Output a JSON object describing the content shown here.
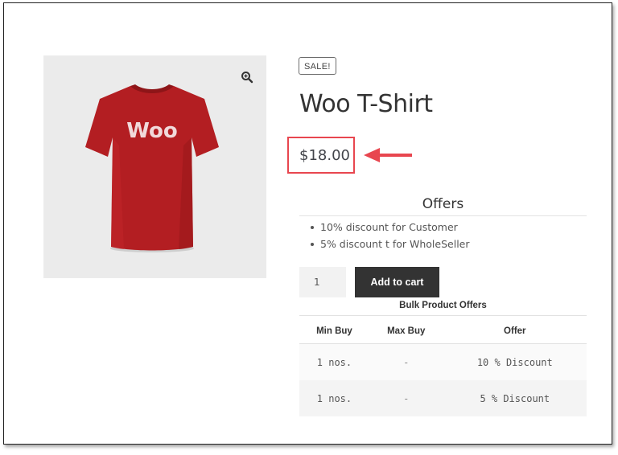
{
  "product": {
    "badge": "SALE!",
    "title": "Woo T-Shirt",
    "price": "$18.00",
    "image_label": "Woo",
    "colors": {
      "shirt": "#b31e22",
      "highlight": "#e8464f",
      "button": "#333333"
    }
  },
  "offers": {
    "title": "Offers",
    "items": [
      "10% discount for Customer",
      "5% discount t for WholeSeller"
    ]
  },
  "cart": {
    "quantity": "1",
    "add_label": "Add to cart"
  },
  "bulk": {
    "title": "Bulk Product Offers",
    "headers": [
      "Min Buy",
      "Max Buy",
      "Offer"
    ],
    "rows": [
      [
        "1 nos.",
        "-",
        "10 % Discount"
      ],
      [
        "1 nos.",
        "-",
        "5 % Discount"
      ]
    ]
  },
  "icons": {
    "zoom": "zoom-in-icon",
    "arrow": "red-arrow-annotation"
  }
}
